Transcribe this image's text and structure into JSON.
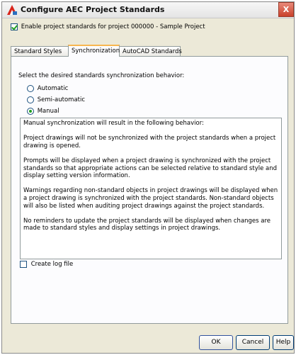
{
  "window": {
    "title": "Configure AEC Project Standards",
    "close_label": "X"
  },
  "enable": {
    "checked": true,
    "label": "Enable project standards for project 000000 - Sample Project"
  },
  "tabs": [
    {
      "label": "Standard Styles",
      "active": false
    },
    {
      "label": "Synchronization",
      "active": true
    },
    {
      "label": "AutoCAD Standards",
      "active": false
    }
  ],
  "sync": {
    "prompt": "Select the desired standards synchronization behavior:",
    "options": [
      {
        "label": "Automatic",
        "selected": false
      },
      {
        "label": "Semi-automatic",
        "selected": false
      },
      {
        "label": "Manual",
        "selected": true
      }
    ],
    "description": [
      "Manual synchronization will result in the following behavior:",
      "Project drawings will not be synchronized with the project standards when a project drawing is opened.",
      "Prompts will be displayed when a project drawing is synchronized with the project standards so that appropriate actions can be selected relative to standard style and display setting version information.",
      "Warnings regarding non-standard objects in project drawings will be displayed when a project drawing is synchronized with the project standards. Non-standard objects will also be listed when auditing project drawings against the project standards.",
      "No reminders to update the project standards will be displayed when changes are made to standard styles and display settings in project drawings."
    ]
  },
  "log": {
    "checked": false,
    "label": "Create log file"
  },
  "buttons": {
    "ok": "OK",
    "cancel": "Cancel",
    "help": "Help"
  }
}
